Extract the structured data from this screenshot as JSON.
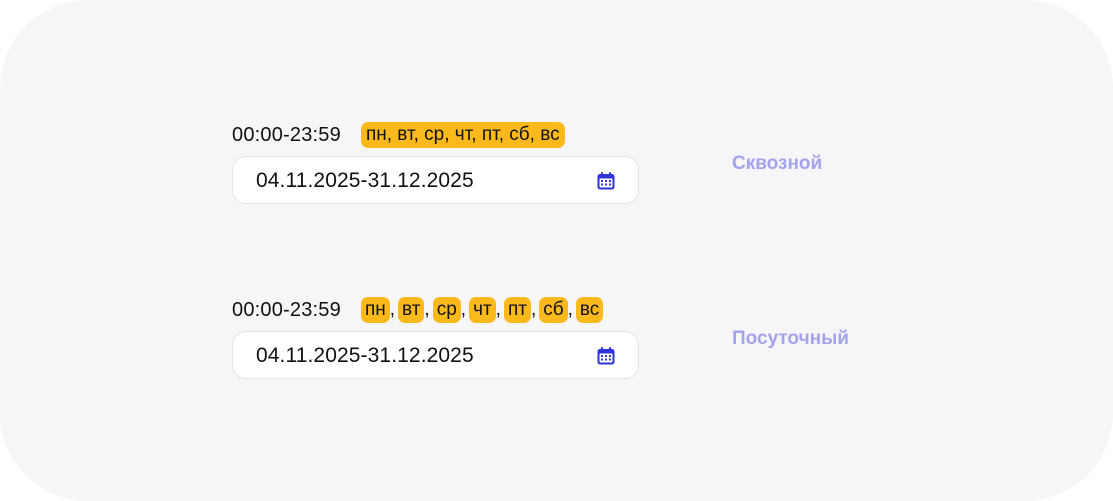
{
  "rows": [
    {
      "time": "00:00-23:59",
      "days_text": "пн, вт, ср, чт, пт, сб, вс",
      "date_range": "04.11.2025-31.12.2025",
      "mode": "Сквозной"
    },
    {
      "time": "00:00-23:59",
      "days": [
        "пн",
        "вт",
        "ср",
        "чт",
        "пт",
        "сб",
        "вс"
      ],
      "separator": ",",
      "date_range": "04.11.2025-31.12.2025",
      "mode": "Посуточный"
    }
  ],
  "colors": {
    "background": "#f6f6f8",
    "day_chip": "#fbb91c",
    "mode_label": "#a4a3ee",
    "calendar_icon": "#2f35d8"
  },
  "icons": {
    "calendar": "calendar-icon"
  }
}
